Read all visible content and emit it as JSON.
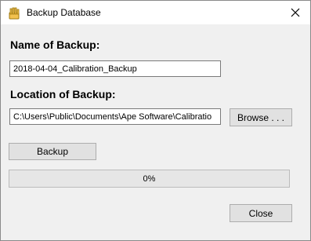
{
  "window": {
    "title": "Backup Database",
    "icon": "hand-database-icon",
    "close_icon": "close-icon"
  },
  "form": {
    "name_label": "Name of Backup:",
    "name_value": "2018-04-04_Calibration_Backup",
    "location_label": "Location of Backup:",
    "location_value": "C:\\Users\\Public\\Documents\\Ape Software\\Calibratio",
    "browse_label": "Browse . . .",
    "backup_label": "Backup",
    "progress_fraction": 0,
    "progress_text": "0%",
    "close_label": "Close"
  },
  "colors": {
    "progress_fill": "#06b025"
  }
}
